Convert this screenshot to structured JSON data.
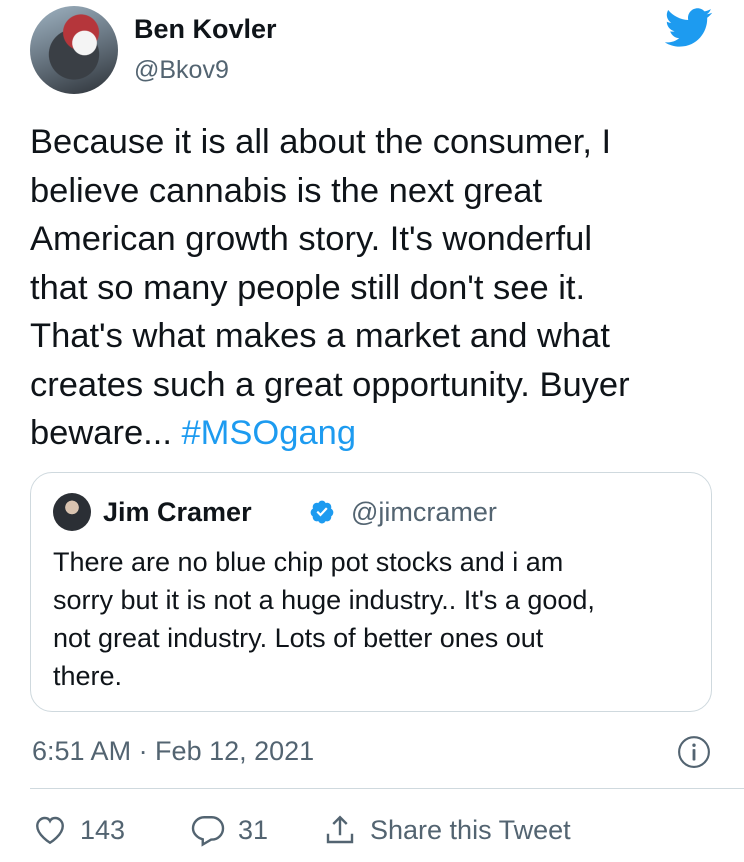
{
  "author": {
    "name": "Ben Kovler",
    "handle": "@Bkov9"
  },
  "tweet": {
    "text_main": "Because it is all about the consumer, I\nbelieve cannabis is the next great\nAmerican growth story. It's wonderful\nthat so many people still don't see it.\nThat's what makes a market and what\ncreates such a great opportunity. Buyer\nbeware... ",
    "hashtag": "#MSOgang"
  },
  "quoted": {
    "name": "Jim Cramer",
    "handle": "@jimcramer",
    "text": "There are no blue chip pot stocks and i am\nsorry but it is not a huge industry.. It's a good,\nnot great industry. Lots of better ones out\nthere."
  },
  "timestamp": "6:51 AM · Feb 12, 2021",
  "actions": {
    "likes": "143",
    "replies": "31",
    "share_label": "Share this Tweet"
  },
  "colors": {
    "accent": "#1d9bf0",
    "secondary_text": "#536471",
    "border": "#cfd9de"
  },
  "icons": [
    "twitter-bird-icon",
    "verified-badge-icon",
    "info-icon",
    "heart-icon",
    "reply-icon",
    "share-icon"
  ]
}
